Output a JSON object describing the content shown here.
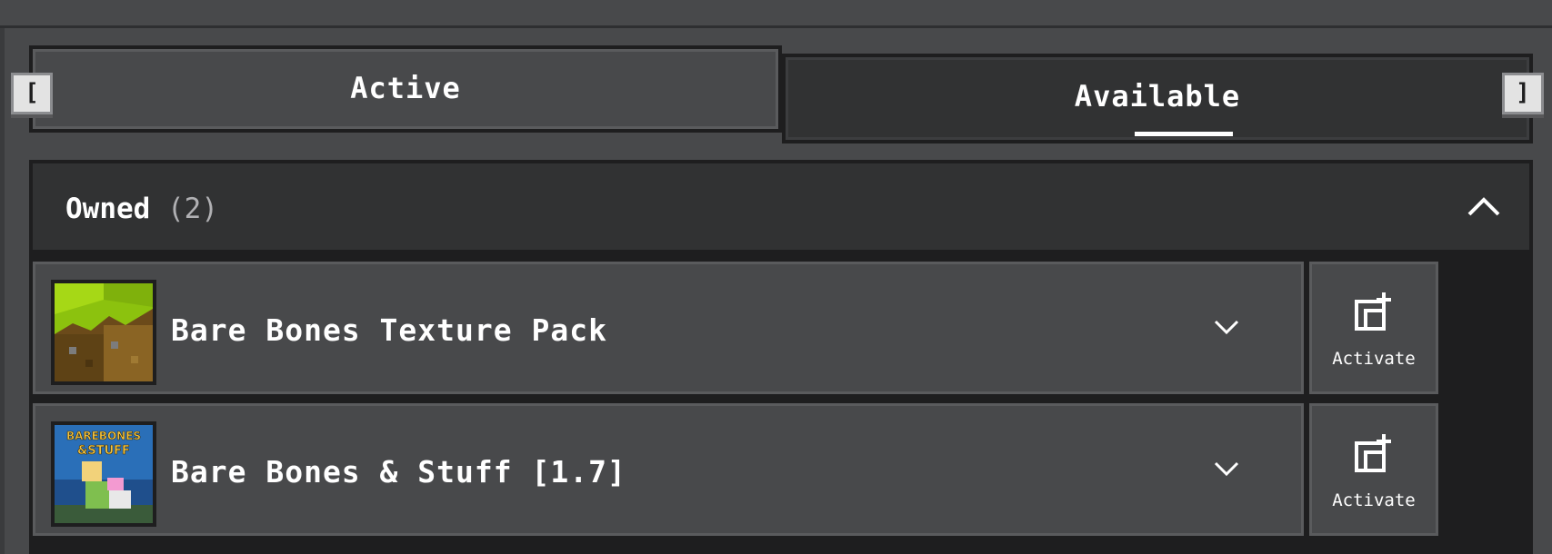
{
  "tabs": {
    "active_label": "Active",
    "available_label": "Available",
    "left_key": "[",
    "right_key": "]"
  },
  "section": {
    "title": "Owned",
    "count": "(2)"
  },
  "packs": [
    {
      "name": "Bare Bones Texture Pack",
      "action_label": "Activate",
      "thumbnail": "grass-block-icon"
    },
    {
      "name": "Bare Bones & Stuff [1.7]",
      "action_label": "Activate",
      "thumbnail": "barebones-stuff-logo",
      "thumbnail_text": "BAREBONES & STUFF"
    }
  ],
  "colors": {
    "background": "#48494b",
    "dark": "#1e1e1f",
    "header": "#313233",
    "text": "#ffffff"
  }
}
